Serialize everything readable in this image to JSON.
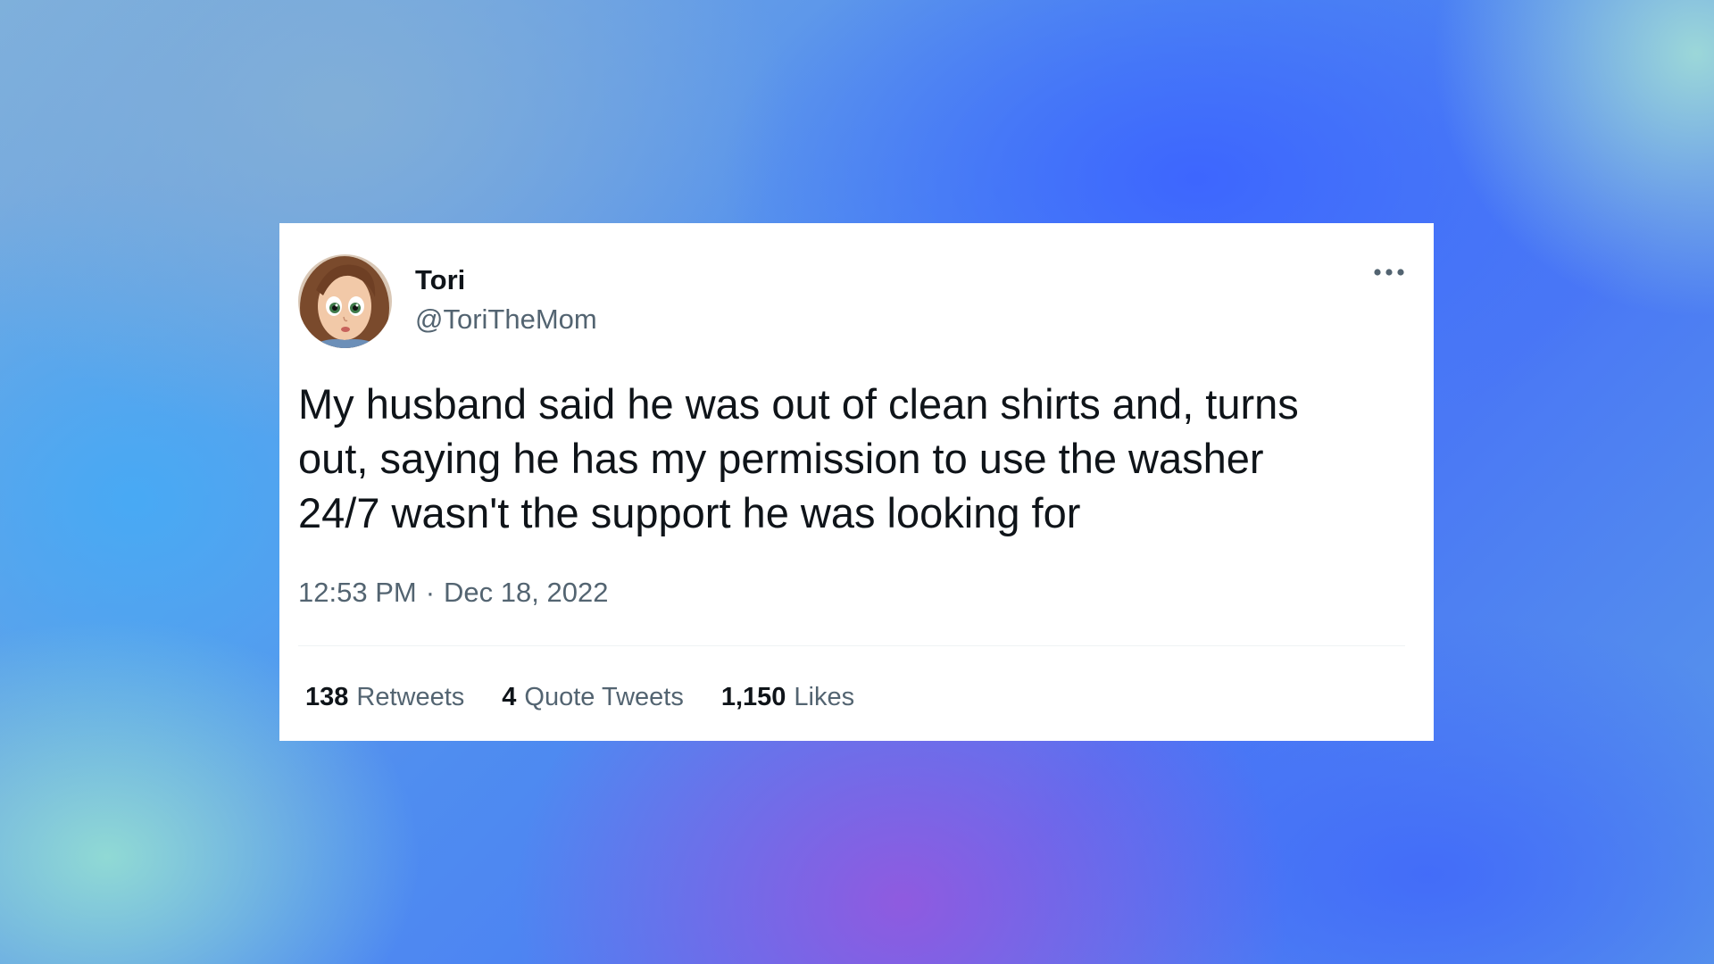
{
  "tweet": {
    "author": {
      "name": "Tori",
      "handle": "@ToriTheMom",
      "avatar_icon": "cartoon-girl-avatar"
    },
    "more_icon": "more-horizontal-icon",
    "text": "My husband said he was out of clean shirts and, turns\nout, saying he has my permission to use the washer\n24/7 wasn't the support he was looking for",
    "time": "12:53 PM",
    "separator": "·",
    "date": "Dec 18, 2022",
    "stats": {
      "retweets": {
        "count": "138",
        "label": "Retweets"
      },
      "quote_tweets": {
        "count": "4",
        "label": "Quote Tweets"
      },
      "likes": {
        "count": "1,150",
        "label": "Likes"
      }
    }
  },
  "colors": {
    "text_primary": "#0f1419",
    "text_secondary": "#536471",
    "card_background": "#ffffff"
  }
}
